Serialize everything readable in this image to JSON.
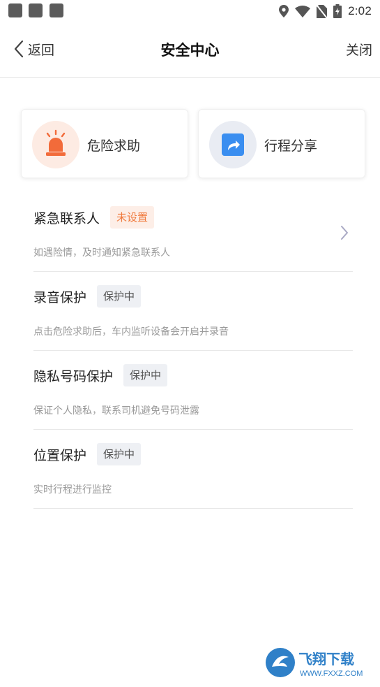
{
  "status_bar": {
    "time": "2:02",
    "icons": [
      "notification-square",
      "notification-square",
      "notification-square",
      "location-icon",
      "wifi-icon",
      "no-sim-icon",
      "battery-charging-icon"
    ]
  },
  "header": {
    "back_label": "返回",
    "title": "安全中心",
    "close_label": "关闭"
  },
  "cards": [
    {
      "label": "危险求助",
      "icon": "alarm-siren-icon",
      "accent": "#f26b3a"
    },
    {
      "label": "行程分享",
      "icon": "share-arrow-icon",
      "accent": "#3a8ef0"
    }
  ],
  "items": [
    {
      "title": "紧急联系人",
      "badge": "未设置",
      "badge_type": "warning",
      "desc": "如遇险情，及时通知紧急联系人",
      "has_chevron": true
    },
    {
      "title": "录音保护",
      "badge": "保护中",
      "badge_type": "active",
      "desc": "点击危险求助后，车内监听设备会开启并录音",
      "has_chevron": false
    },
    {
      "title": "隐私号码保护",
      "badge": "保护中",
      "badge_type": "active",
      "desc": "保证个人隐私，联系司机避免号码泄露",
      "has_chevron": false
    },
    {
      "title": "位置保护",
      "badge": "保护中",
      "badge_type": "active",
      "desc": "实时行程进行监控",
      "has_chevron": false
    }
  ],
  "watermark": {
    "text": "飞翔下载",
    "url": "WWW.FXXZ.COM"
  },
  "colors": {
    "warning_text": "#f07a3d",
    "warning_bg": "#fdeee7",
    "active_bg": "#eef0f4",
    "share_blue": "#3a8ef0",
    "siren_orange": "#f26b3a"
  }
}
